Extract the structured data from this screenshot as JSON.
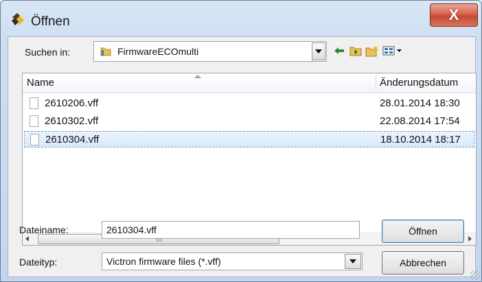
{
  "window": {
    "title": "Öffnen"
  },
  "lookin": {
    "label": "Suchen in:",
    "value": "FirmwareECOmulti"
  },
  "filelist": {
    "columns": [
      "Name",
      "Änderungsdatum"
    ],
    "rows": [
      {
        "name": "2610206.vff",
        "date": "28.01.2014 18:30",
        "selected": false
      },
      {
        "name": "2610302.vff",
        "date": "22.08.2014 17:54",
        "selected": false
      },
      {
        "name": "2610304.vff",
        "date": "18.10.2014 18:17",
        "selected": true
      }
    ]
  },
  "filename": {
    "label": "Dateiname:",
    "value": "2610304.vff"
  },
  "filetype": {
    "label": "Dateityp:",
    "value": "Victron firmware files (*.vff)"
  },
  "buttons": {
    "open": "Öffnen",
    "cancel": "Abbrechen",
    "close": "X"
  },
  "icons": {
    "title": "app-icon",
    "folder": "folder-icon",
    "back": "back-arrow-icon",
    "up": "up-folder-icon",
    "newfolder": "new-folder-icon",
    "views": "view-menu-icon"
  },
  "colors": {
    "selection": "#d8e9fb",
    "close": "#c24a34",
    "window": "#cfdff1"
  }
}
